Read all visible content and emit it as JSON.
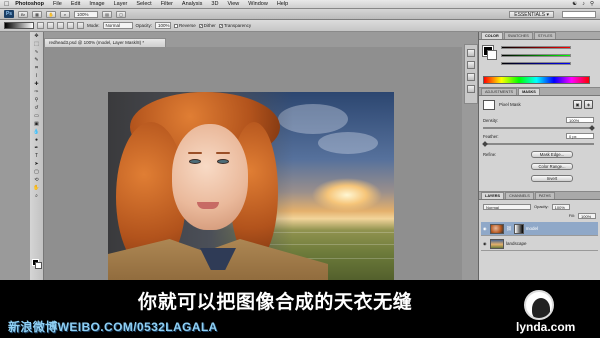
{
  "menubar": {
    "app": "Photoshop",
    "items": [
      "File",
      "Edit",
      "Image",
      "Layer",
      "Select",
      "Filter",
      "Analysis",
      "3D",
      "View",
      "Window",
      "Help"
    ]
  },
  "appbar": {
    "logo": "Ps",
    "zoom": "100%",
    "workspace": "ESSENTIALS ▾"
  },
  "options": {
    "mode_label": "Mode:",
    "mode_value": "Normal",
    "opacity_label": "Opacity:",
    "opacity_value": "100%",
    "reverse": "Reverse",
    "dither": "Dither",
    "transparency": "Transparency"
  },
  "document": {
    "tab_title": "redhead3.psd @ 100% (model, Layer Mask/8) *"
  },
  "panels": {
    "color_tabs": [
      "COLOR",
      "SWATCHES",
      "STYLES"
    ],
    "adjust_tabs": [
      "ADJUSTMENTS",
      "MASKS"
    ],
    "mask_title": "Pixel Mask",
    "density_label": "Density:",
    "density_value": "100%",
    "feather_label": "Feather:",
    "feather_value": "0 px",
    "refine_label": "Refine:",
    "mask_edge": "Mask Edge...",
    "color_range": "Color Range...",
    "invert": "Invert",
    "layers_tabs": [
      "LAYERS",
      "CHANNELS",
      "PATHS"
    ],
    "blend_mode": "Normal",
    "opacity_label": "Opacity:",
    "opacity_value": "100%",
    "fill_label": "Fill:",
    "fill_value": "100%",
    "layers": [
      {
        "name": "model",
        "selected": true
      },
      {
        "name": "landscape",
        "selected": false
      }
    ]
  },
  "caption": {
    "subtitle": "你就可以把图像合成的天衣无缝",
    "weibo": "新浪微博WEIBO.COM/0532LAGALA",
    "brand": "lynda.com"
  },
  "colors": {
    "accent": "#8fa8c8",
    "weibo": "#8fd0f4"
  }
}
